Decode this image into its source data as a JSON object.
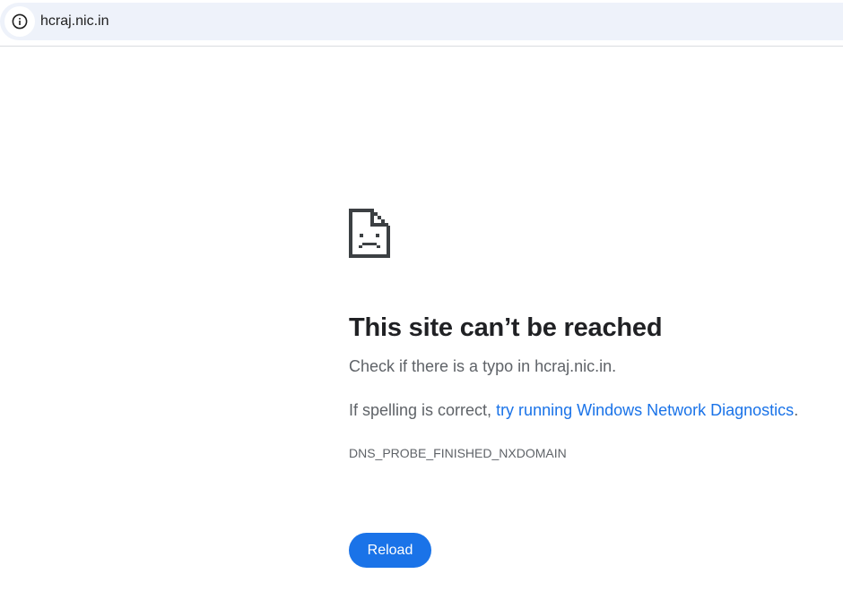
{
  "address_bar": {
    "site_info_icon": "info-circle-icon",
    "url": "hcraj.nic.in"
  },
  "error_page": {
    "icon": "sad-document-icon",
    "heading": "This site can’t be reached",
    "line1": "Check if there is a typo in hcraj.nic.in.",
    "line2_prefix": "If spelling is correct, ",
    "line2_link": "try running Windows Network Diagnostics",
    "line2_suffix": ".",
    "error_code": "DNS_PROBE_FINISHED_NXDOMAIN",
    "reload_label": "Reload"
  },
  "colors": {
    "link": "#1a73e8",
    "button_bg": "#1a73e8",
    "omnibox_bg": "#eef2fa",
    "heading": "#202124",
    "body_text": "#5f6368"
  }
}
